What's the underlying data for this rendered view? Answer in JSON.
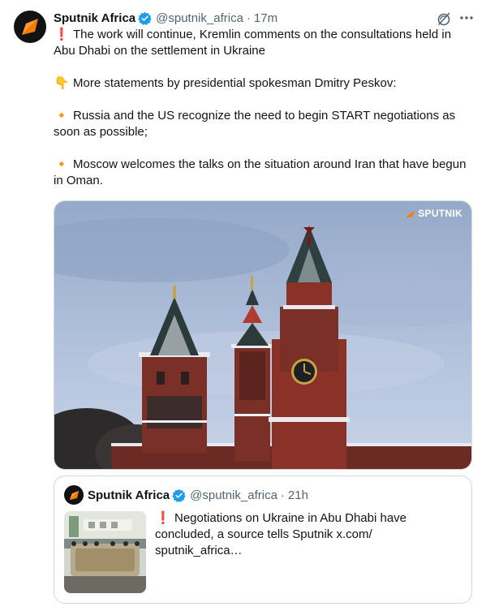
{
  "author": {
    "name": "Sputnik Africa",
    "handle": "@sputnik_africa",
    "separator": "·",
    "time": "17m"
  },
  "tweet": {
    "line1": "The work will continue, Kremlin comments on the consultations held in Abu Dhabi on the settlement in Ukraine",
    "line2": "More statements by presidential spokesman Dmitry Peskov:",
    "line3": "Russia and the US recognize the need to begin START negotiations as soon as possible;",
    "line4": "Moscow welcomes the talks on the situation around Iran that have begun in Oman.",
    "emoji1": "❗",
    "emoji2": "👇",
    "emoji3": "🔸",
    "emoji4": "🔸"
  },
  "media": {
    "watermark": "SPUTNIK"
  },
  "quote": {
    "name": "Sputnik Africa",
    "handle": "@sputnik_africa",
    "separator": "·",
    "time": "21h",
    "emoji": "❗",
    "text": "Negotiations on Ukraine in Abu Dhabi have concluded, a source tells Sputnik  x.com/ sputnik_africa…"
  },
  "icons": {
    "avatar": "sputnik-logo-icon",
    "verified": "verified-badge-icon",
    "grok": "grok-icon",
    "more": "more-icon"
  },
  "colors": {
    "verified": "#1d9bf0",
    "secondary_text": "#536471",
    "sputnik_orange": "#f57c00",
    "border": "#cfd9de"
  }
}
